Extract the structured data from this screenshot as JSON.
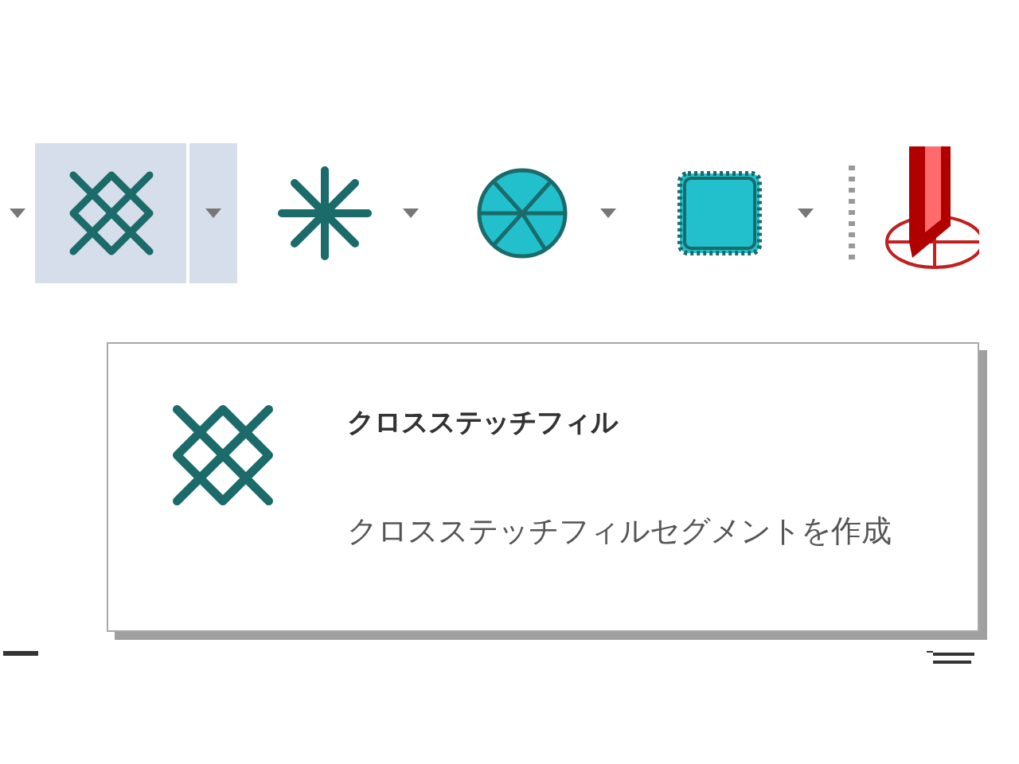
{
  "toolbar": {
    "tools": [
      {
        "kind": "cross-stitch",
        "selected": true
      },
      {
        "kind": "star",
        "selected": false
      },
      {
        "kind": "circle",
        "selected": false
      },
      {
        "kind": "square",
        "selected": false
      }
    ]
  },
  "tooltip": {
    "kind": "cross-stitch",
    "title": "クロスステッチフィル",
    "description": "クロスステッチフィルセグメントを作成"
  }
}
